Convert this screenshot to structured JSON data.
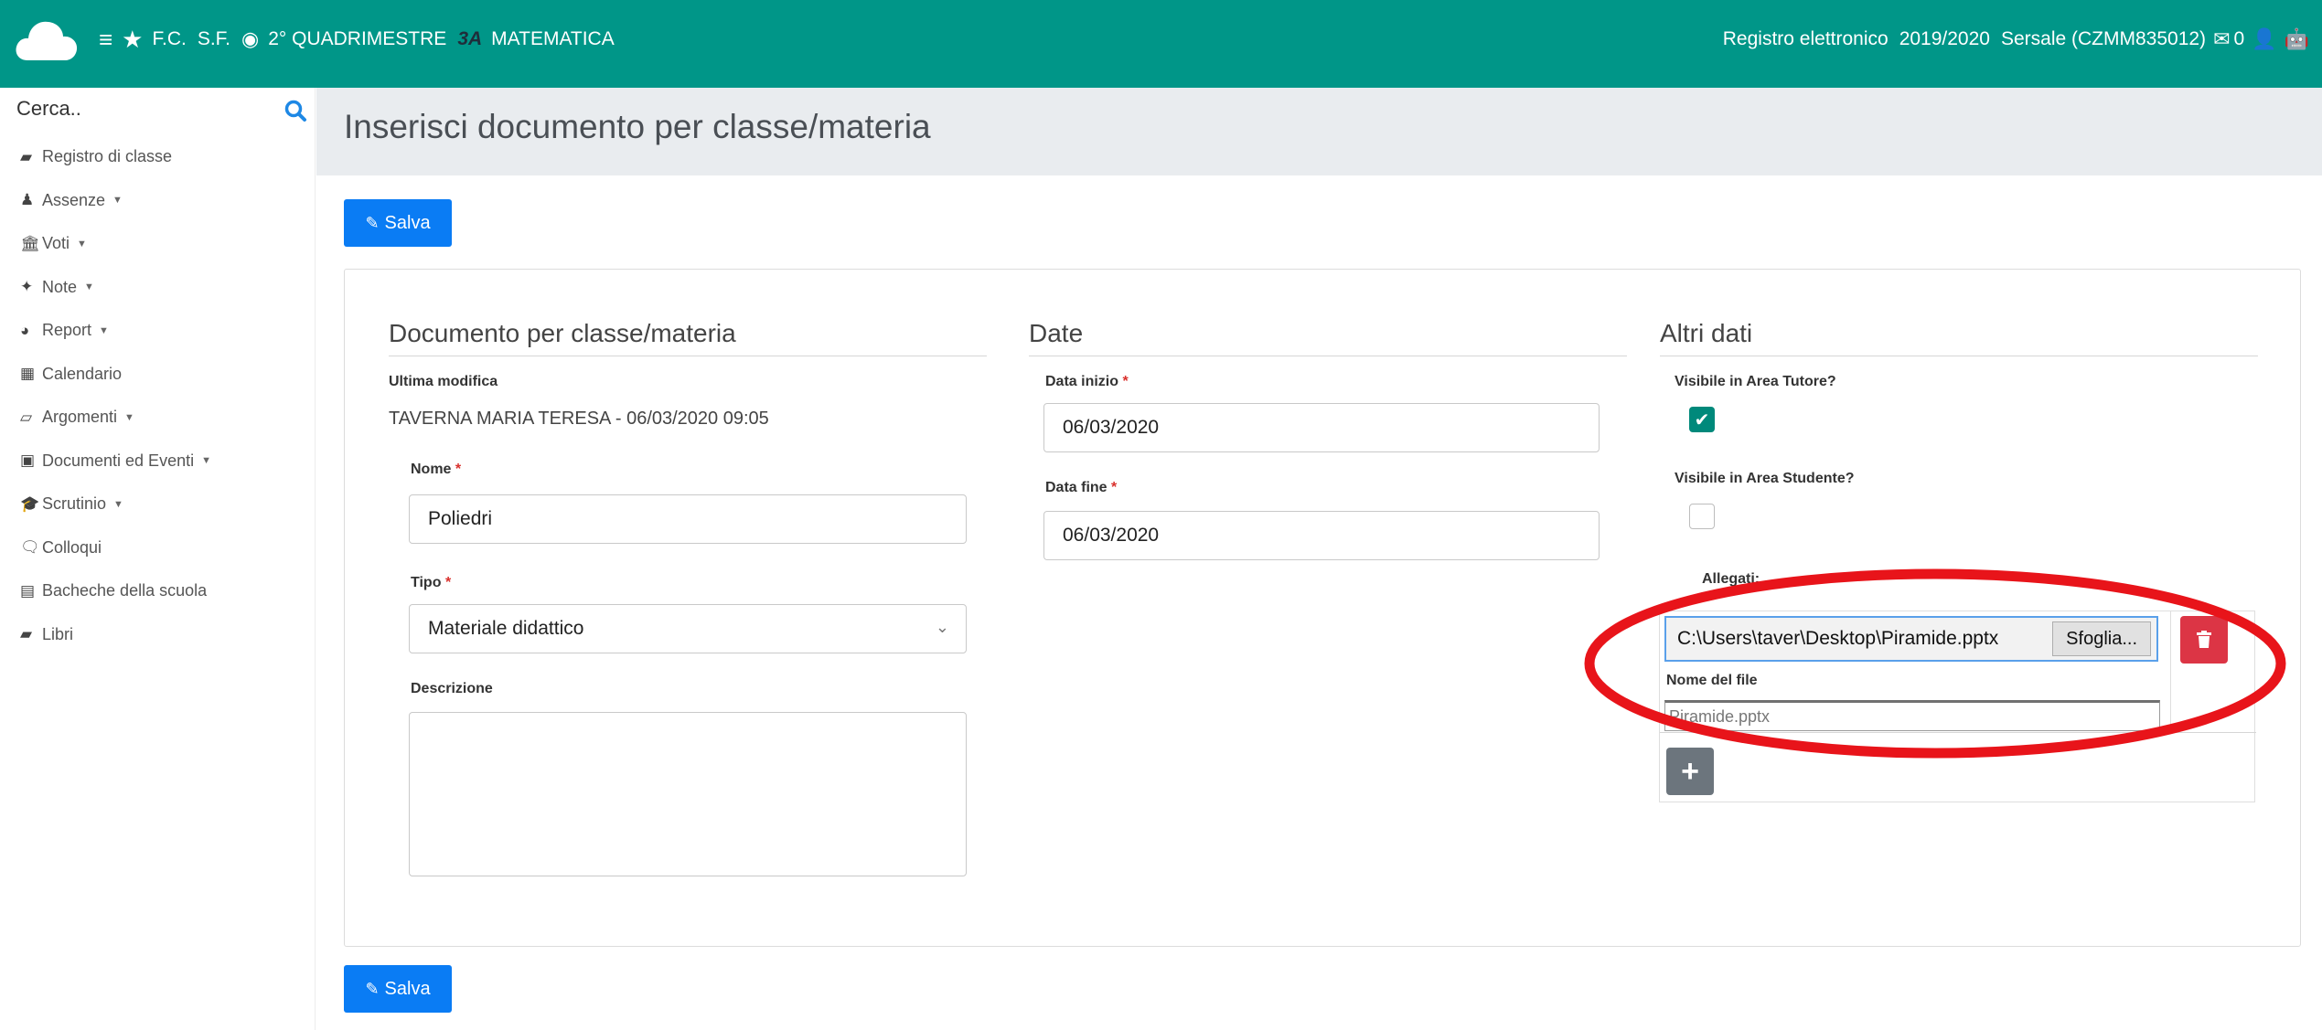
{
  "topbar": {
    "menu_icon": "hamburger-icon",
    "star_icon": "star-icon",
    "item1": "F.C.",
    "item2": "S.F.",
    "eye_icon": "eye-icon",
    "period": "2° QUADRIMESTRE",
    "class": "3A",
    "subject": "MATEMATICA",
    "registro": "Registro elettronico",
    "year": "2019/2020",
    "school": "Sersale (CZMM835012)",
    "messages_count": "0",
    "accent_color": "#009688"
  },
  "sidebar": {
    "search_label": "Cerca..",
    "items": [
      {
        "label": "Registro di classe",
        "icon": "book-icon"
      },
      {
        "label": "Assenze",
        "icon": "user-icon",
        "dropdown": true
      },
      {
        "label": "Voti",
        "icon": "institution-icon",
        "dropdown": true
      },
      {
        "label": "Note",
        "icon": "pin-icon",
        "dropdown": true
      },
      {
        "label": "Report",
        "icon": "pie-chart-icon",
        "dropdown": true
      },
      {
        "label": "Calendario",
        "icon": "calendar-icon"
      },
      {
        "label": "Argomenti",
        "icon": "folder-icon",
        "dropdown": true
      },
      {
        "label": "Documenti ed Eventi",
        "icon": "archive-icon",
        "dropdown": true
      },
      {
        "label": "Scrutinio",
        "icon": "graduation-cap-icon",
        "dropdown": true
      },
      {
        "label": "Colloqui",
        "icon": "chat-icon"
      },
      {
        "label": "Bacheche della scuola",
        "icon": "board-icon"
      },
      {
        "label": "Libri",
        "icon": "book-icon"
      }
    ]
  },
  "page": {
    "title": "Inserisci documento per classe/materia",
    "save_label": "Salva"
  },
  "form": {
    "doc": {
      "title": "Documento per classe/materia",
      "last_mod_label": "Ultima modifica",
      "last_mod_value": "TAVERNA MARIA TERESA - 06/03/2020 09:05",
      "name_label": "Nome",
      "name_value": "Poliedri",
      "type_label": "Tipo",
      "type_value": "Materiale didattico",
      "desc_label": "Descrizione",
      "desc_value": ""
    },
    "dates": {
      "title": "Date",
      "start_label": "Data inizio",
      "start_value": "06/03/2020",
      "end_label": "Data fine",
      "end_value": "06/03/2020"
    },
    "other": {
      "title": "Altri dati",
      "tutor_label": "Visibile in Area Tutore?",
      "tutor_checked": true,
      "student_label": "Visibile in Area Studente?",
      "student_checked": false,
      "attach_label": "Allegati:",
      "file_path": "C:\\Users\\taver\\Desktop\\Piramide.pptx",
      "browse_label": "Sfoglia...",
      "filename_label": "Nome del file",
      "filename_value": "Piramide.pptx"
    },
    "required_mark": "*"
  },
  "annotation": {
    "color": "#e8141a"
  }
}
